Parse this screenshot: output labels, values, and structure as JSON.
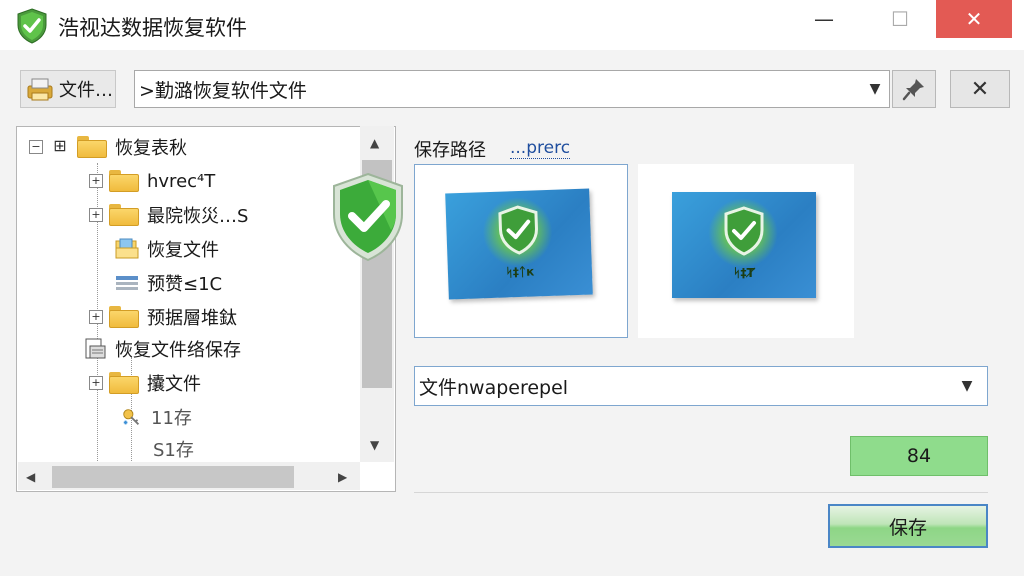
{
  "window": {
    "title": "浩视达数据恢复软件",
    "minimize_glyph": "—",
    "maximize_glyph": "☐",
    "close_glyph": "✕"
  },
  "toolbar": {
    "file_button_label": "文件…",
    "path_value": ">勤潞恢复软件文件",
    "dropdown_glyph": "▼",
    "clear_glyph": "✕"
  },
  "tree": {
    "items": [
      {
        "label": "恢复表秋",
        "icon": "folder-icon"
      },
      {
        "label": "hvrec⁴T",
        "icon": "folder-icon"
      },
      {
        "label": "最院恢災…S",
        "icon": "folder-icon"
      },
      {
        "label": "恢复文件",
        "icon": "folder-open-icon"
      },
      {
        "label": "预赞≤1C",
        "icon": "list-icon"
      },
      {
        "label": "预据層堆鈦",
        "icon": "folder-icon"
      },
      {
        "label": "恢复文件络保存",
        "icon": "document-icon"
      },
      {
        "label": "攮文件",
        "icon": "folder-icon"
      },
      {
        "label": "11存",
        "icon": "key-icon"
      },
      {
        "label": "S1存",
        "icon": "none"
      }
    ],
    "scroll_up_glyph": "▲",
    "scroll_down_glyph": "▼",
    "scroll_left_glyph": "◀",
    "scroll_right_glyph": "▶"
  },
  "right": {
    "save_path_label": "保存路径",
    "save_path_link": "...prerc",
    "thumbnails": [
      {
        "tag": "ᛋ‡ᛏк"
      },
      {
        "tag": "ᛋ‡Ⱦ"
      }
    ],
    "name_value": "文件nwaperepel",
    "value_box": "84",
    "save_button": "保存"
  },
  "colors": {
    "close_button": "#e35a54",
    "value_box": "#8fdc8c",
    "shield_green": "#3cab3a"
  }
}
